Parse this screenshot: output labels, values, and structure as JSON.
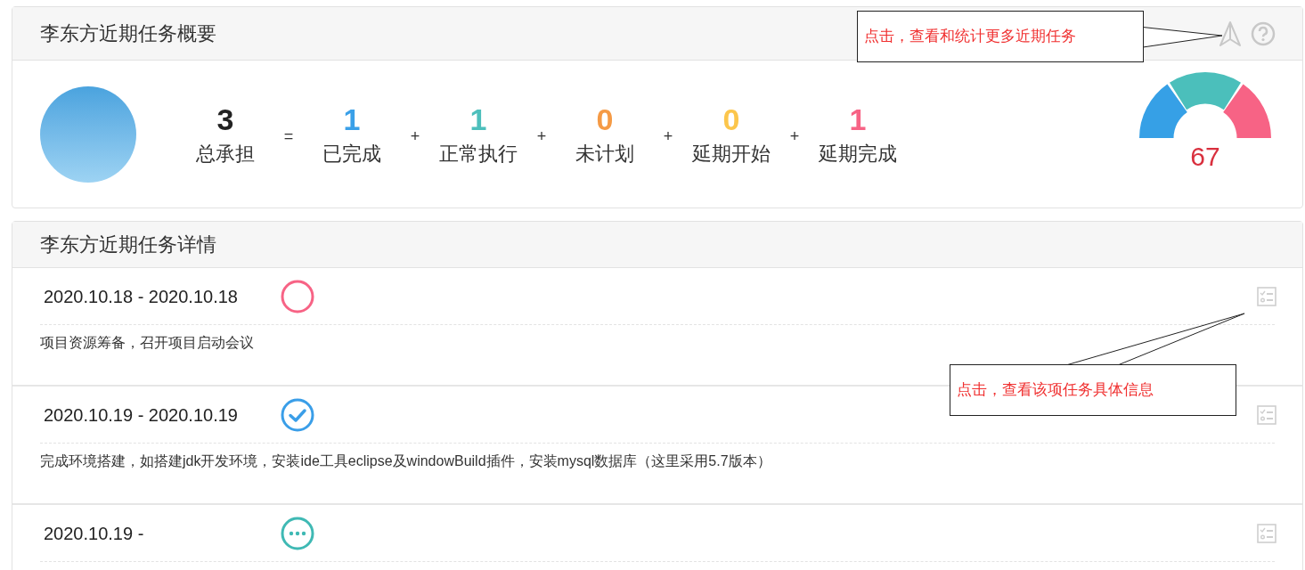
{
  "summary": {
    "title": "李东方近期任务概要",
    "stats": [
      {
        "value": "3",
        "label": "总承担",
        "color": "#222222"
      },
      {
        "operator": "=",
        "value": "1",
        "label": "已完成",
        "color": "#3aa0e8"
      },
      {
        "operator": "+",
        "value": "1",
        "label": "正常执行",
        "color": "#4dbfbc"
      },
      {
        "operator": "+",
        "value": "0",
        "label": "未计划",
        "color": "#f59a45"
      },
      {
        "operator": "+",
        "value": "0",
        "label": "延期开始",
        "color": "#fcc64c"
      },
      {
        "operator": "+",
        "value": "1",
        "label": "延期完成",
        "color": "#f76385"
      }
    ],
    "gauge": {
      "value": "67"
    }
  },
  "details": {
    "title": "李东方近期任务详情",
    "tasks": [
      {
        "dates": "2020.10.18 - 2020.10.18",
        "kind": "not_started",
        "description": "项目资源筹备，召开项目启动会议"
      },
      {
        "dates": "2020.10.19 - 2020.10.19",
        "kind": "done",
        "description": "完成环境搭建，如搭建jdk开发环境，安装ide工具eclipse及windowBuild插件，安装mysql数据库（这里采用5.7版本）"
      },
      {
        "dates": "2020.10.19 -",
        "kind": "in_progress"
      }
    ]
  },
  "callouts": [
    {
      "text": "点击，查看和统计更多近期任务"
    },
    {
      "text": "点击，查看该项任务具体信息"
    }
  ]
}
